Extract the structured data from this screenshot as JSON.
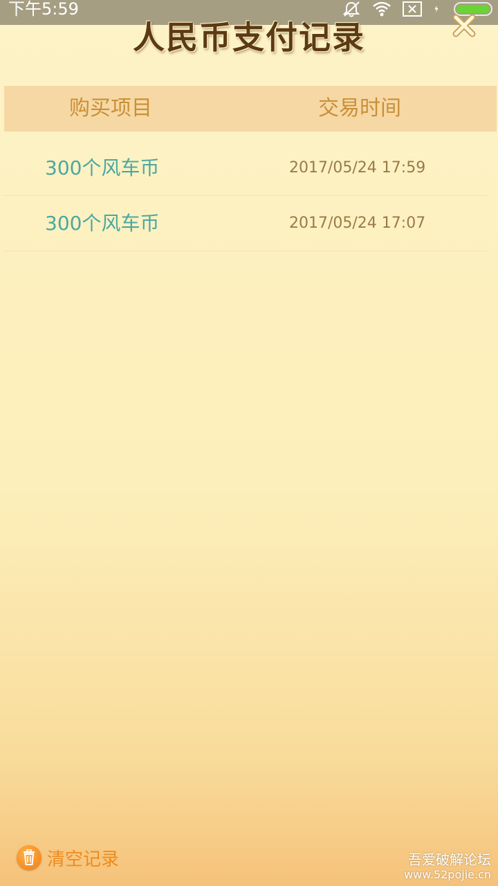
{
  "status": {
    "time": "下午5:59",
    "icons": [
      "bell-off-icon",
      "wifi-icon",
      "sim-x-icon",
      "charging-icon",
      "battery-icon"
    ],
    "battery_color": "#6bd336"
  },
  "title": "人民币支付记录",
  "table": {
    "headers": {
      "item": "购买项目",
      "time": "交易时间"
    },
    "rows": [
      {
        "item": "300个风车币",
        "time": "2017/05/24 17:59"
      },
      {
        "item": "300个风车币",
        "time": "2017/05/24 17:07"
      }
    ]
  },
  "footer": {
    "clear_label": "清空记录"
  },
  "watermark": {
    "line1": "吾爱破解论坛",
    "line2": "www.52pojie.cn"
  },
  "colors": {
    "header_bg": "#f6d8a4",
    "header_text": "#c98f38",
    "item_text": "#4aa8a0",
    "time_text": "#9a7a48",
    "accent_orange": "#f08a1c",
    "title_text": "#5c3a12"
  }
}
